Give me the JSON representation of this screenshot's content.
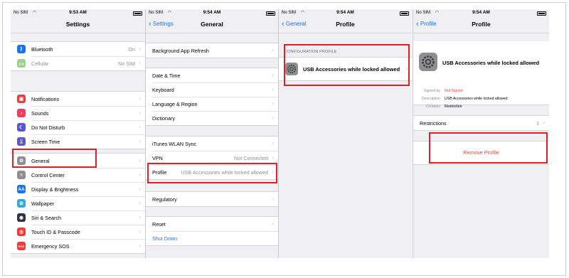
{
  "colors": {
    "accent": "#1a73e8",
    "highlight": "#dd1f26",
    "destructive": "#ff3b30"
  },
  "screens": [
    {
      "status": {
        "carrier": "No SIM",
        "time": "9:53 AM"
      },
      "title": "Settings",
      "groups": [
        [
          {
            "label": "Bluetooth",
            "value": "On",
            "icon": "bluetooth-icon",
            "color": "#1a73e8",
            "glyph": "ᛒ"
          },
          {
            "label": "Cellular",
            "value": "No SIM",
            "icon": "cellular-icon",
            "color": "#9ad48c",
            "glyph": "((·))",
            "muted": true
          }
        ],
        [
          {
            "label": "Notifications",
            "icon": "notifications-icon",
            "color": "#ef3b3b",
            "glyph": "▣"
          },
          {
            "label": "Sounds",
            "icon": "sounds-icon",
            "color": "#ef3b5c",
            "glyph": "♪"
          },
          {
            "label": "Do Not Disturb",
            "icon": "moon-icon",
            "color": "#5856d6",
            "glyph": "☾"
          },
          {
            "label": "Screen Time",
            "icon": "hourglass-icon",
            "color": "#5856d6",
            "glyph": "⌛"
          }
        ],
        [
          {
            "label": "General",
            "icon": "gear-icon",
            "color": "#8e8e93",
            "glyph": "⚙"
          },
          {
            "label": "Control Center",
            "icon": "toggles-icon",
            "color": "#8e8e93",
            "glyph": "≡"
          },
          {
            "label": "Display & Brightness",
            "icon": "display-icon",
            "color": "#1a73e8",
            "glyph": "AA"
          },
          {
            "label": "Wallpaper",
            "icon": "wallpaper-icon",
            "color": "#34aadc",
            "glyph": "✿"
          },
          {
            "label": "Siri & Search",
            "icon": "siri-icon",
            "color": "#333344",
            "glyph": "◉"
          },
          {
            "label": "Touch ID & Passcode",
            "icon": "fingerprint-icon",
            "color": "#ef3b3b",
            "glyph": "◎"
          },
          {
            "label": "Emergency SOS",
            "icon": "sos-icon",
            "color": "#ef3b3b",
            "glyph": "SOS"
          }
        ]
      ]
    },
    {
      "status": {
        "carrier": "No SIM",
        "time": "9:54 AM"
      },
      "back": "Settings",
      "title": "General",
      "groups": [
        [
          {
            "label": "Background App Refresh"
          }
        ],
        [
          {
            "label": "Date & Time"
          },
          {
            "label": "Keyboard"
          },
          {
            "label": "Language & Region"
          },
          {
            "label": "Dictionary"
          }
        ],
        [
          {
            "label": "iTunes WLAN Sync"
          },
          {
            "label": "VPN",
            "value": "Not Connected"
          },
          {
            "label": "Profile",
            "value": "USB Accessories while locked allowed"
          }
        ],
        [
          {
            "label": "Regulatory"
          }
        ],
        [
          {
            "label": "Reset"
          },
          {
            "label": "Shut Down",
            "link": true
          }
        ]
      ]
    },
    {
      "status": {
        "carrier": "No SIM",
        "time": "9:54 AM"
      },
      "back": "General",
      "title": "Profile",
      "section_caption": "CONFIGURATION PROFILE",
      "profile_name": "USB Accessories while locked allowed"
    },
    {
      "status": {
        "carrier": "No SIM",
        "time": "9:54 AM"
      },
      "back": "Profile",
      "title": "Profile",
      "profile_name": "USB Accessories while locked allowed",
      "details": [
        {
          "key": "Signed by",
          "value": "Not Signed",
          "red": true
        },
        {
          "key": "Description",
          "value": "USB Accessories while locked allowed"
        },
        {
          "key": "Contains",
          "value": "Restriction"
        }
      ],
      "restrictions": {
        "label": "Restrictions",
        "value": "1"
      },
      "remove_label": "Remove Profile"
    }
  ]
}
